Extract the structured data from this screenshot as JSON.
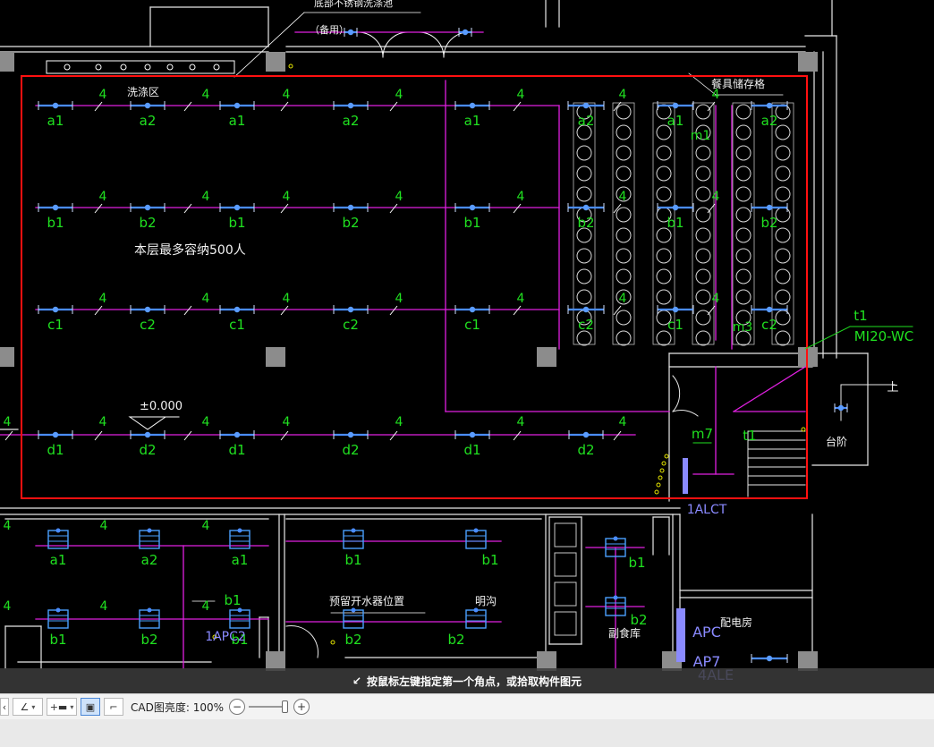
{
  "canvas": {
    "labels": {
      "wash_area": "洗涤区",
      "tableware_storage": "餐具储存格",
      "capacity": "本层最多容纳500人",
      "elevation": "±0.000",
      "side_wash_top": "底部不锈钢洗涤池",
      "side_hood": "（备用）",
      "reserved_water_heater": "预留开水器位置",
      "open_drain": "明沟",
      "staple_storage": "副食库",
      "power_room": "配电房",
      "steps": "台阶",
      "up_mark": "上",
      "panel_1alct": "1ALCT",
      "panel_1apc2": "1APC2",
      "panel_apc": "APC",
      "panel_ap7": "AP7",
      "panel_4ale": "4ALE",
      "t1_label": "t1",
      "mi20_label": "MI20-WC",
      "m7_label": "m7",
      "t1_label2": "t1"
    },
    "circuit_count": "4",
    "fixture_tags": {
      "row_a": [
        "a1",
        "a2",
        "a1",
        "a2",
        "a1"
      ],
      "row_b": [
        "b1",
        "b2",
        "b1",
        "b2",
        "b1"
      ],
      "row_c": [
        "c1",
        "c2",
        "c1",
        "c2",
        "c1"
      ],
      "row_d": [
        "d1",
        "d2",
        "d1",
        "d2",
        "d1",
        "d2"
      ],
      "right_a": [
        "a2",
        "a1",
        "a2"
      ],
      "right_b": [
        "b2",
        "b1",
        "b2"
      ],
      "right_c": [
        "c2",
        "c1",
        "c2"
      ],
      "m1": "m1",
      "m3": "m3",
      "lower_left_top": [
        "a1",
        "a2",
        "a1"
      ],
      "lower_left_bottom": [
        "b1",
        "b2",
        "b1"
      ],
      "lower_mid_top": [
        "b1",
        "b1"
      ],
      "lower_mid_bottom": [
        "b2",
        "b2"
      ],
      "lower_right_b1": "b1",
      "lower_right_b2": "b2",
      "lower_left_b1_extra": "b1"
    }
  },
  "hint": {
    "icon": "corner-select-icon",
    "text": "按鼠标左键指定第一个角点，或拾取构件图元"
  },
  "toolbar": {
    "brightness_label": "CAD图亮度:",
    "brightness_value": "100%",
    "zoom_out": "−",
    "zoom_in": "+",
    "brightness_level": 1.0
  }
}
